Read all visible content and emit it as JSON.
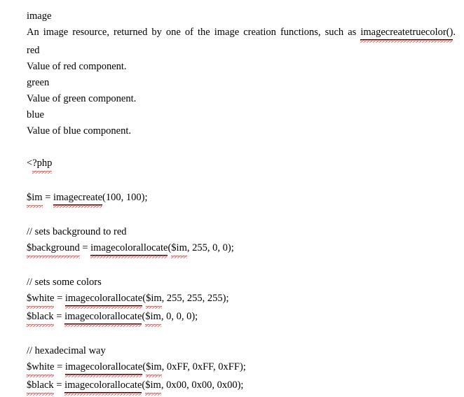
{
  "document": {
    "params": [
      {
        "name": "image",
        "description_parts": [
          {
            "text": "An image resource, returned by one of the image creation functions, such as ",
            "mark": "none"
          },
          {
            "text": "imagecreatetruecolor()",
            "mark": "link-spell"
          },
          {
            "text": ".",
            "mark": "none"
          }
        ],
        "description_plain": "An image resource, returned by one of the image creation functions, such as imagecreatetruecolor()."
      },
      {
        "name": "red",
        "description_plain": "Value of red component."
      },
      {
        "name": "green",
        "description_plain": "Value of green component."
      },
      {
        "name": "blue",
        "description_plain": "Value of blue component."
      }
    ],
    "code": {
      "open_tag": "<?php",
      "lines": [
        {
          "id": "create",
          "text": "$im = imagecreate(100, 100);"
        },
        {
          "id": "comment_bg",
          "text": "// sets background to red"
        },
        {
          "id": "bg",
          "text": "$background = imagecolorallocate($im, 255, 0, 0);"
        },
        {
          "id": "comment_colors",
          "text": "// sets some colors"
        },
        {
          "id": "white_dec",
          "text": "$white = imagecolorallocate($im, 255, 255, 255);"
        },
        {
          "id": "black_dec",
          "text": "$black = imagecolorallocate($im, 0, 0, 0);"
        },
        {
          "id": "comment_hex",
          "text": "// hexadecimal way"
        },
        {
          "id": "white_hex",
          "text": "$white = imagecolorallocate($im, 0xFF, 0xFF, 0xFF);"
        },
        {
          "id": "black_hex",
          "text": "$black = imagecolorallocate($im, 0x00, 0x00, 0x00);"
        }
      ],
      "tokens": {
        "php": "?php",
        "lt": "<",
        "im": "$im",
        "imagecreate": "imagecreate",
        "imagecreate_args": "(100, 100);",
        "equals": " = ",
        "comment_bg": "// sets background to red",
        "background_var": "$background",
        "imagecolorallocate": "imagecolorallocate",
        "paren_open": "(",
        "comma": ", ",
        "args_bg": ", 255, 0, 0);",
        "comment_colors": "// sets some colors",
        "white_var": "$white",
        "black_var": "$black",
        "args_white_dec": ", 255, 255, 255);",
        "args_black_dec": ", 0, 0, 0);",
        "comment_hex": "// hexadecimal way",
        "args_white_hex": ", 0xFF, 0xFF, 0xFF);",
        "args_black_hex": ", 0x00, 0x00, 0x00);"
      }
    }
  },
  "colors": {
    "text": "#000000",
    "background": "#ffffff",
    "spellcheck_underline": "#e02020"
  }
}
